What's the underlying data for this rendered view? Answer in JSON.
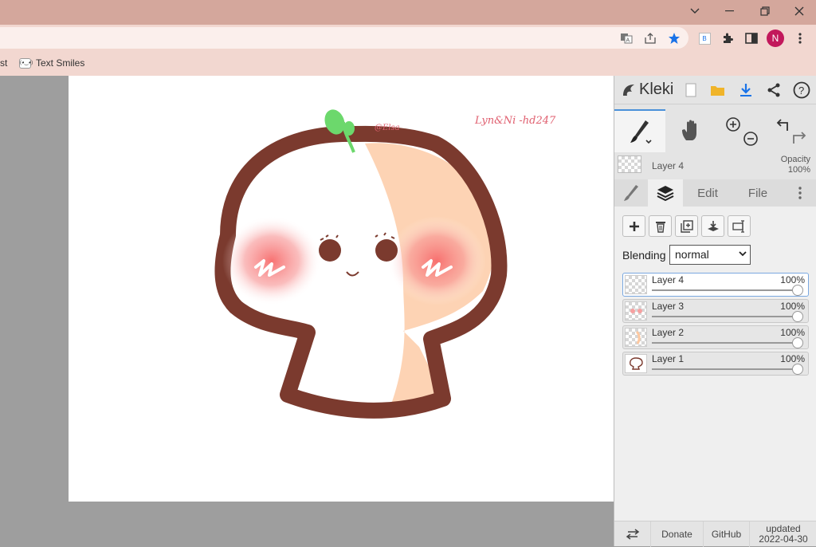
{
  "browser": {
    "window_controls": [
      "chevron-down",
      "minimize",
      "restore",
      "close"
    ],
    "toolbar_icons": [
      "translate-icon",
      "share-icon",
      "star-icon",
      "extension-b-icon",
      "puzzle-icon",
      "sidepanel-icon",
      "profile-avatar",
      "menu-icon"
    ],
    "profile_initial": "N",
    "bookmarks": {
      "partial_first": "st",
      "text_smiles": "Text Smiles",
      "text_smiles_favicon": "(◕‿◕)"
    }
  },
  "artwork": {
    "signature_top": "@Elsa",
    "signature_right": "Lyn&Ni -hd247",
    "colors": {
      "outline": "#7b3a2e",
      "peach": "#fdd3b4",
      "blush": "#f47a7a",
      "sprout": "#6cd86c"
    }
  },
  "kleki": {
    "logo_text": "Kleki",
    "header_icons": [
      "new-file-icon",
      "open-folder-icon",
      "download-icon",
      "share-icon",
      "help-icon"
    ],
    "tools": [
      "brush-tool",
      "hand-tool",
      "zoom-in-icon",
      "zoom-out-icon",
      "undo-icon",
      "redo-icon"
    ],
    "current_layer": {
      "name": "Layer 4",
      "opacity_label": "Opacity",
      "opacity_value": "100%"
    },
    "tabs": {
      "edit": "Edit",
      "file": "File"
    },
    "layer_actions": [
      "add-layer",
      "delete-layer",
      "duplicate-layer",
      "merge-down",
      "rename-layer"
    ],
    "blending": {
      "label": "Blending",
      "value": "normal"
    },
    "layers": [
      {
        "name": "Layer 4",
        "opacity": "100%",
        "selected": true
      },
      {
        "name": "Layer 3",
        "opacity": "100%",
        "selected": false
      },
      {
        "name": "Layer 2",
        "opacity": "100%",
        "selected": false
      },
      {
        "name": "Layer 1",
        "opacity": "100%",
        "selected": false
      }
    ],
    "footer": {
      "donate": "Donate",
      "github": "GitHub",
      "updated_label": "updated",
      "updated_date": "2022-04-30"
    }
  }
}
